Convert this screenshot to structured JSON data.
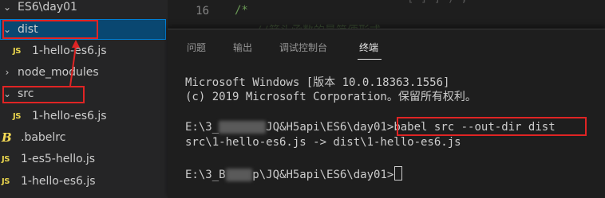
{
  "explorer": {
    "root": {
      "label": "ES6\\day01"
    },
    "items": [
      {
        "label": "dist",
        "kind": "folder",
        "expanded": true,
        "selected": true
      },
      {
        "label": "1-hello-es6.js",
        "kind": "js"
      },
      {
        "label": "node_modules",
        "kind": "folder",
        "expanded": false
      },
      {
        "label": "src",
        "kind": "folder",
        "expanded": true
      },
      {
        "label": "1-hello-es6.js",
        "kind": "js"
      },
      {
        "label": ".babelrc",
        "kind": "babel"
      },
      {
        "label": "1-es5-hello.js",
        "kind": "js"
      },
      {
        "label": "1-hello-es6.js",
        "kind": "js"
      }
    ],
    "js_icon_text": "JS"
  },
  "editor": {
    "line_number": "16",
    "line_text": "/*",
    "faded_text": "//箭头函数的最简便形式"
  },
  "panel": {
    "tabs": [
      {
        "label": "问题",
        "active": false
      },
      {
        "label": "输出",
        "active": false
      },
      {
        "label": "调试控制台",
        "active": false
      },
      {
        "label": "终端",
        "active": true
      }
    ],
    "terminal": {
      "line1": "Microsoft Windows [版本 10.0.18363.1556]",
      "line2": "(c) 2019 Microsoft Corporation。保留所有权利。",
      "prompt1_a": "E:\\3_",
      "prompt1_b": "JQ&H5api\\ES6\\day01>",
      "command": "babel src --out-dir dist",
      "output": "src\\1-hello-es6.js -> dist\\1-hello-es6.js",
      "prompt2_a": "E:\\3_B",
      "prompt2_b": "p\\JQ&H5api\\ES6\\day01>"
    }
  },
  "colors": {
    "annotation": "#e02424",
    "selection": "#094771",
    "comment": "#6a9955"
  }
}
